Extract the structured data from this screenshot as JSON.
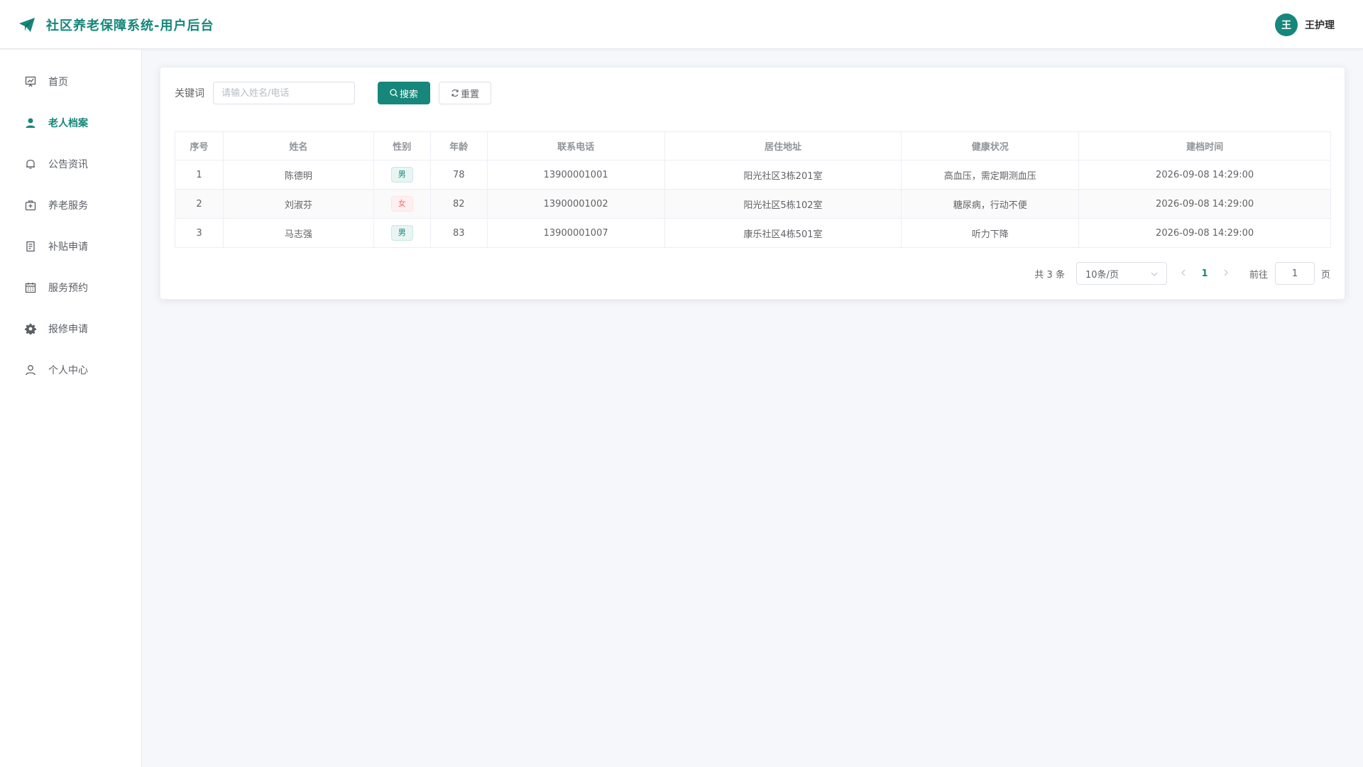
{
  "header": {
    "title": "社区养老保障系统-用户后台",
    "user_avatar_char": "王",
    "user_name": "王护理"
  },
  "sidebar": {
    "items": [
      {
        "label": "首页",
        "icon": "dashboard-icon",
        "active": false
      },
      {
        "label": "老人档案",
        "icon": "user-filled-icon",
        "active": true
      },
      {
        "label": "公告资讯",
        "icon": "bell-icon",
        "active": false
      },
      {
        "label": "养老服务",
        "icon": "first-aid-kit-icon",
        "active": false
      },
      {
        "label": "补贴申请",
        "icon": "document-icon",
        "active": false
      },
      {
        "label": "服务预约",
        "icon": "calendar-icon",
        "active": false
      },
      {
        "label": "报修申请",
        "icon": "gear-icon",
        "active": false
      },
      {
        "label": "个人中心",
        "icon": "user-icon",
        "active": false
      }
    ]
  },
  "search": {
    "label": "关键词",
    "placeholder": "请输入姓名/电话",
    "search_label": "搜索",
    "reset_label": "重置"
  },
  "table": {
    "columns": [
      "序号",
      "姓名",
      "性别",
      "年龄",
      "联系电话",
      "居住地址",
      "健康状况",
      "建档时间"
    ],
    "rows": [
      {
        "index": "1",
        "name": "陈德明",
        "gender": "男",
        "age": "78",
        "phone": "13900001001",
        "address": "阳光社区3栋201室",
        "health": "高血压，需定期测血压",
        "created": "2026-09-08 14:29:00"
      },
      {
        "index": "2",
        "name": "刘淑芬",
        "gender": "女",
        "age": "82",
        "phone": "13900001002",
        "address": "阳光社区5栋102室",
        "health": "糖尿病，行动不便",
        "created": "2026-09-08 14:29:00"
      },
      {
        "index": "3",
        "name": "马志强",
        "gender": "男",
        "age": "83",
        "phone": "13900001007",
        "address": "康乐社区4栋501室",
        "health": "听力下降",
        "created": "2026-09-08 14:29:00"
      }
    ]
  },
  "pagination": {
    "total": "共 3 条",
    "page_size": "10条/页",
    "current_page": "1",
    "goto_label": "前往",
    "goto_value": "1",
    "goto_suffix": "页"
  },
  "colors": {
    "primary": "#16877a",
    "female_tag": "#f56c6c"
  }
}
